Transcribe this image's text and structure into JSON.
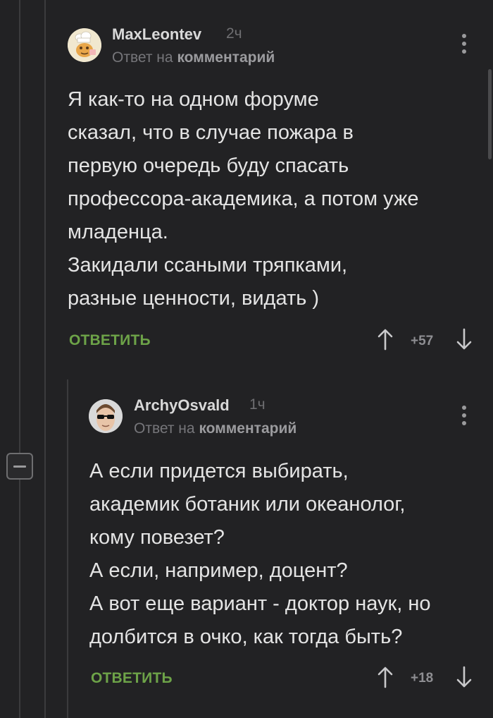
{
  "comments": [
    {
      "username": "MaxLeontev",
      "time": "2ч",
      "reply_prefix": "Ответ на",
      "reply_target": "комментарий",
      "avatar": "chef-cartoon-avatar",
      "text_lines": [
        "Я как-то на одном форуме",
        "сказал, что в случае пожара в",
        "первую очередь буду спасать",
        "профессора-академика, а потом уже",
        "младенца.",
        "Закидали ссаными тряпками,",
        "разные ценности, видать )"
      ],
      "reply_label": "ОТВЕТИТЬ",
      "rating": "+57"
    },
    {
      "username": "ArchyOsvald",
      "time": "1ч",
      "reply_prefix": "Ответ на",
      "reply_target": "комментарий",
      "avatar": "sunglasses-photo-avatar",
      "text_lines": [
        "А если придется выбирать,",
        "академик ботаник или океанолог,",
        "кому повезет?",
        "А если, например, доцент?",
        "А вот еще вариант - доктор наук, но",
        "долбится в очко, как тогда быть?"
      ],
      "reply_label": "ОТВЕТИТЬ",
      "rating": "+18"
    }
  ],
  "icons": {
    "collapse": "minus-square-icon",
    "menu": "kebab-menu-icon",
    "upvote": "arrow-up-icon",
    "downvote": "arrow-down-icon"
  },
  "colors": {
    "background": "#222224",
    "accent": "#6da348",
    "thread_line": "#3b3b3d"
  }
}
